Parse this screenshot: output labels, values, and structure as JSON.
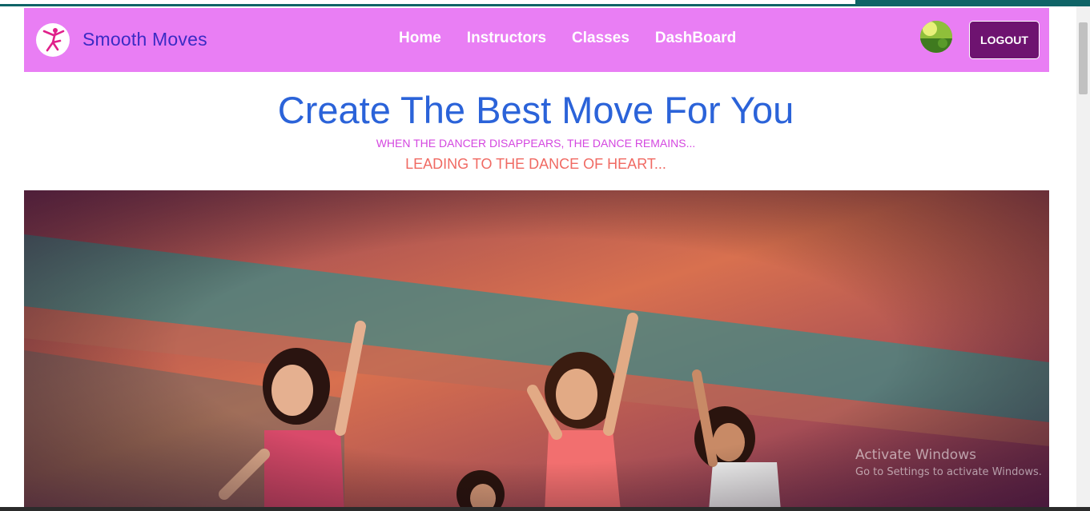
{
  "brand": {
    "name": "Smooth Moves",
    "logo_icon": "dancer-icon"
  },
  "nav": {
    "links": [
      "Home",
      "Instructors",
      "Classes",
      "DashBoard"
    ],
    "logout_label": "LOGOUT"
  },
  "hero": {
    "title": "Create The Best Move For You",
    "subtitle_1": "WHEN THE DANCER DISAPPEARS, THE DANCE REMAINS...",
    "subtitle_2": "LEADING TO THE DANCE OF HEART..."
  },
  "watermark": {
    "title": "Activate Windows",
    "subtitle": "Go to Settings to activate Windows."
  },
  "colors": {
    "navbar": "#e97ef4",
    "brand_text": "#3b2bc4",
    "logout_bg": "#6e1370",
    "title": "#2b63d9",
    "subtitle_1": "#d447e0",
    "subtitle_2": "#f06a63"
  }
}
